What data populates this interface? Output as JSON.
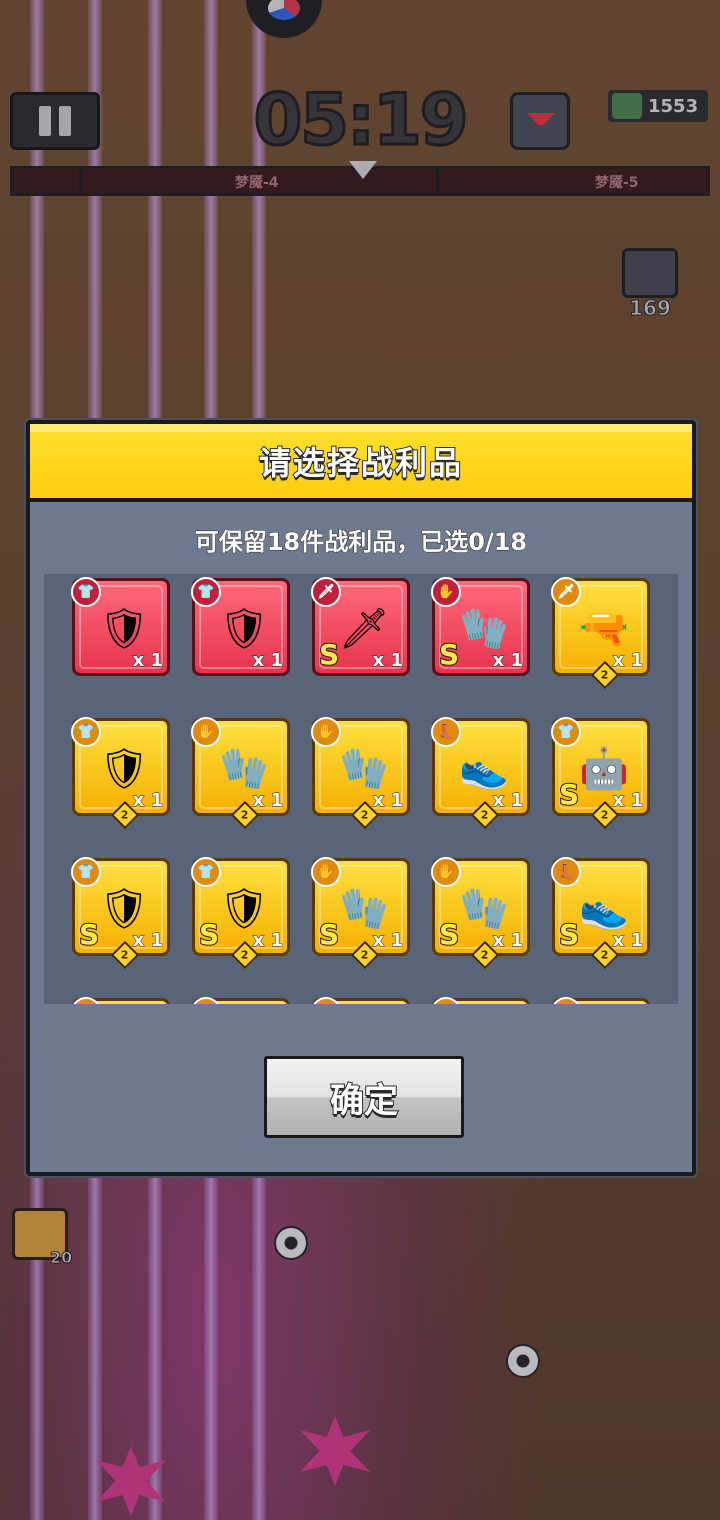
{
  "hud": {
    "timer": "05:19",
    "kill_count": "1553",
    "stage_current": "梦魇-4",
    "stage_next": "梦魇-5",
    "chest_count": "169",
    "skill_count": "20"
  },
  "dialog": {
    "title": "请选择战利品",
    "subtitle": "可保留18件战利品，已选0/18",
    "confirm_label": "确定",
    "items": [
      {
        "name": "green-dragon-armor",
        "rarity": "red",
        "slot": "armor",
        "grade": "",
        "qty": "x 1",
        "level": ""
      },
      {
        "name": "green-dragon-armor",
        "rarity": "red",
        "slot": "armor",
        "grade": "",
        "qty": "x 1",
        "level": ""
      },
      {
        "name": "flame-sword",
        "rarity": "red",
        "slot": "weapon",
        "grade": "S",
        "qty": "x 1",
        "level": ""
      },
      {
        "name": "tech-gauntlet",
        "rarity": "red",
        "slot": "glove",
        "grade": "S",
        "qty": "x 1",
        "level": ""
      },
      {
        "name": "revolver",
        "rarity": "gold",
        "slot": "weapon",
        "grade": "",
        "qty": "x 1",
        "level": "2"
      },
      {
        "name": "steel-armor",
        "rarity": "gold",
        "slot": "armor",
        "grade": "",
        "qty": "x 1",
        "level": "2"
      },
      {
        "name": "steel-gauntlet",
        "rarity": "gold",
        "slot": "glove",
        "grade": "",
        "qty": "x 1",
        "level": "2"
      },
      {
        "name": "steel-gauntlet",
        "rarity": "gold",
        "slot": "glove",
        "grade": "",
        "qty": "x 1",
        "level": "2"
      },
      {
        "name": "purple-boots",
        "rarity": "gold",
        "slot": "boots",
        "grade": "",
        "qty": "x 1",
        "level": "2"
      },
      {
        "name": "mecha-armor",
        "rarity": "gold",
        "slot": "armor",
        "grade": "S",
        "qty": "x 1",
        "level": "2"
      },
      {
        "name": "dark-armor",
        "rarity": "gold",
        "slot": "armor",
        "grade": "S",
        "qty": "x 1",
        "level": "2"
      },
      {
        "name": "void-armor",
        "rarity": "gold",
        "slot": "armor",
        "grade": "S",
        "qty": "x 1",
        "level": "2"
      },
      {
        "name": "claw-gauntlet",
        "rarity": "gold",
        "slot": "glove",
        "grade": "S",
        "qty": "x 1",
        "level": "2"
      },
      {
        "name": "claw-gauntlet",
        "rarity": "gold",
        "slot": "glove",
        "grade": "S",
        "qty": "x 1",
        "level": "2"
      },
      {
        "name": "mecha-boots",
        "rarity": "gold",
        "slot": "boots",
        "grade": "S",
        "qty": "x 1",
        "level": "2"
      },
      {
        "name": "item-partial",
        "rarity": "gold",
        "slot": "weapon",
        "grade": "",
        "qty": "",
        "level": ""
      },
      {
        "name": "item-partial",
        "rarity": "gold",
        "slot": "armor",
        "grade": "",
        "qty": "",
        "level": ""
      },
      {
        "name": "item-partial",
        "rarity": "gold",
        "slot": "glove",
        "grade": "",
        "qty": "",
        "level": ""
      },
      {
        "name": "item-partial",
        "rarity": "gold",
        "slot": "boots",
        "grade": "",
        "qty": "",
        "level": ""
      },
      {
        "name": "item-partial",
        "rarity": "gold",
        "slot": "weapon",
        "grade": "",
        "qty": "",
        "level": ""
      }
    ]
  },
  "colors": {
    "header_yellow": "#ffd416",
    "panel_gray": "#6f7a90",
    "rarity_red": "#e8344e",
    "rarity_gold": "#f6b000"
  },
  "icons": {
    "armor": "shirt-icon",
    "weapon": "sword-icon",
    "glove": "glove-icon",
    "boots": "boot-icon"
  }
}
